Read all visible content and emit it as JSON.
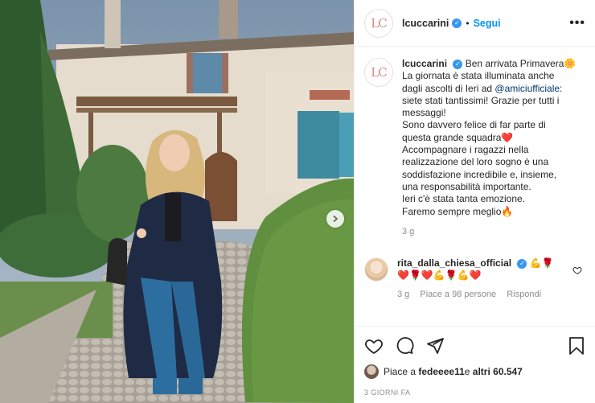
{
  "post": {
    "username": "lcuccarini",
    "avatar_initials": "LC",
    "follow_label": "Segui",
    "dot": "•",
    "more_label": "•••"
  },
  "caption": {
    "username": "lcuccarini",
    "lines": [
      "Ben arrivata Primavera🌼",
      "La giornata è stata illuminata anche",
      "dagli ascolti di Ieri ad ",
      "siete stati tantissimi! Grazie per tutti i",
      "messaggi!",
      "Sono davvero felice di far parte di",
      "questa grande squadra❤️",
      "Accompagnare i ragazzi nella",
      "realizzazione del loro sogno è una",
      "soddisfazione incredibile e, insieme,",
      "una responsabilità importante.",
      "Ieri c'è stata tanta emozione.",
      "Faremo sempre meglio🔥"
    ],
    "mention": "@amiciufficiale:",
    "time": "3 g"
  },
  "comment": {
    "username": "rita_dalla_chiesa_official",
    "emoji_after_name": "💪🌹",
    "text": "❤️🌹❤️💪🌹💪❤️",
    "time": "3 g",
    "likes": "Piace a 98 persone",
    "reply_label": "Rispondi"
  },
  "footer": {
    "likes_prefix": "Piace a ",
    "likes_user": "fedeeee11",
    "likes_mid": " e ",
    "likes_others": "altri 60.547",
    "time_ago": "3 giorni fa"
  },
  "colors": {
    "link": "#0095f6",
    "mention": "#00376b",
    "verified": "#3897f0",
    "muted": "#8e8e8e"
  }
}
